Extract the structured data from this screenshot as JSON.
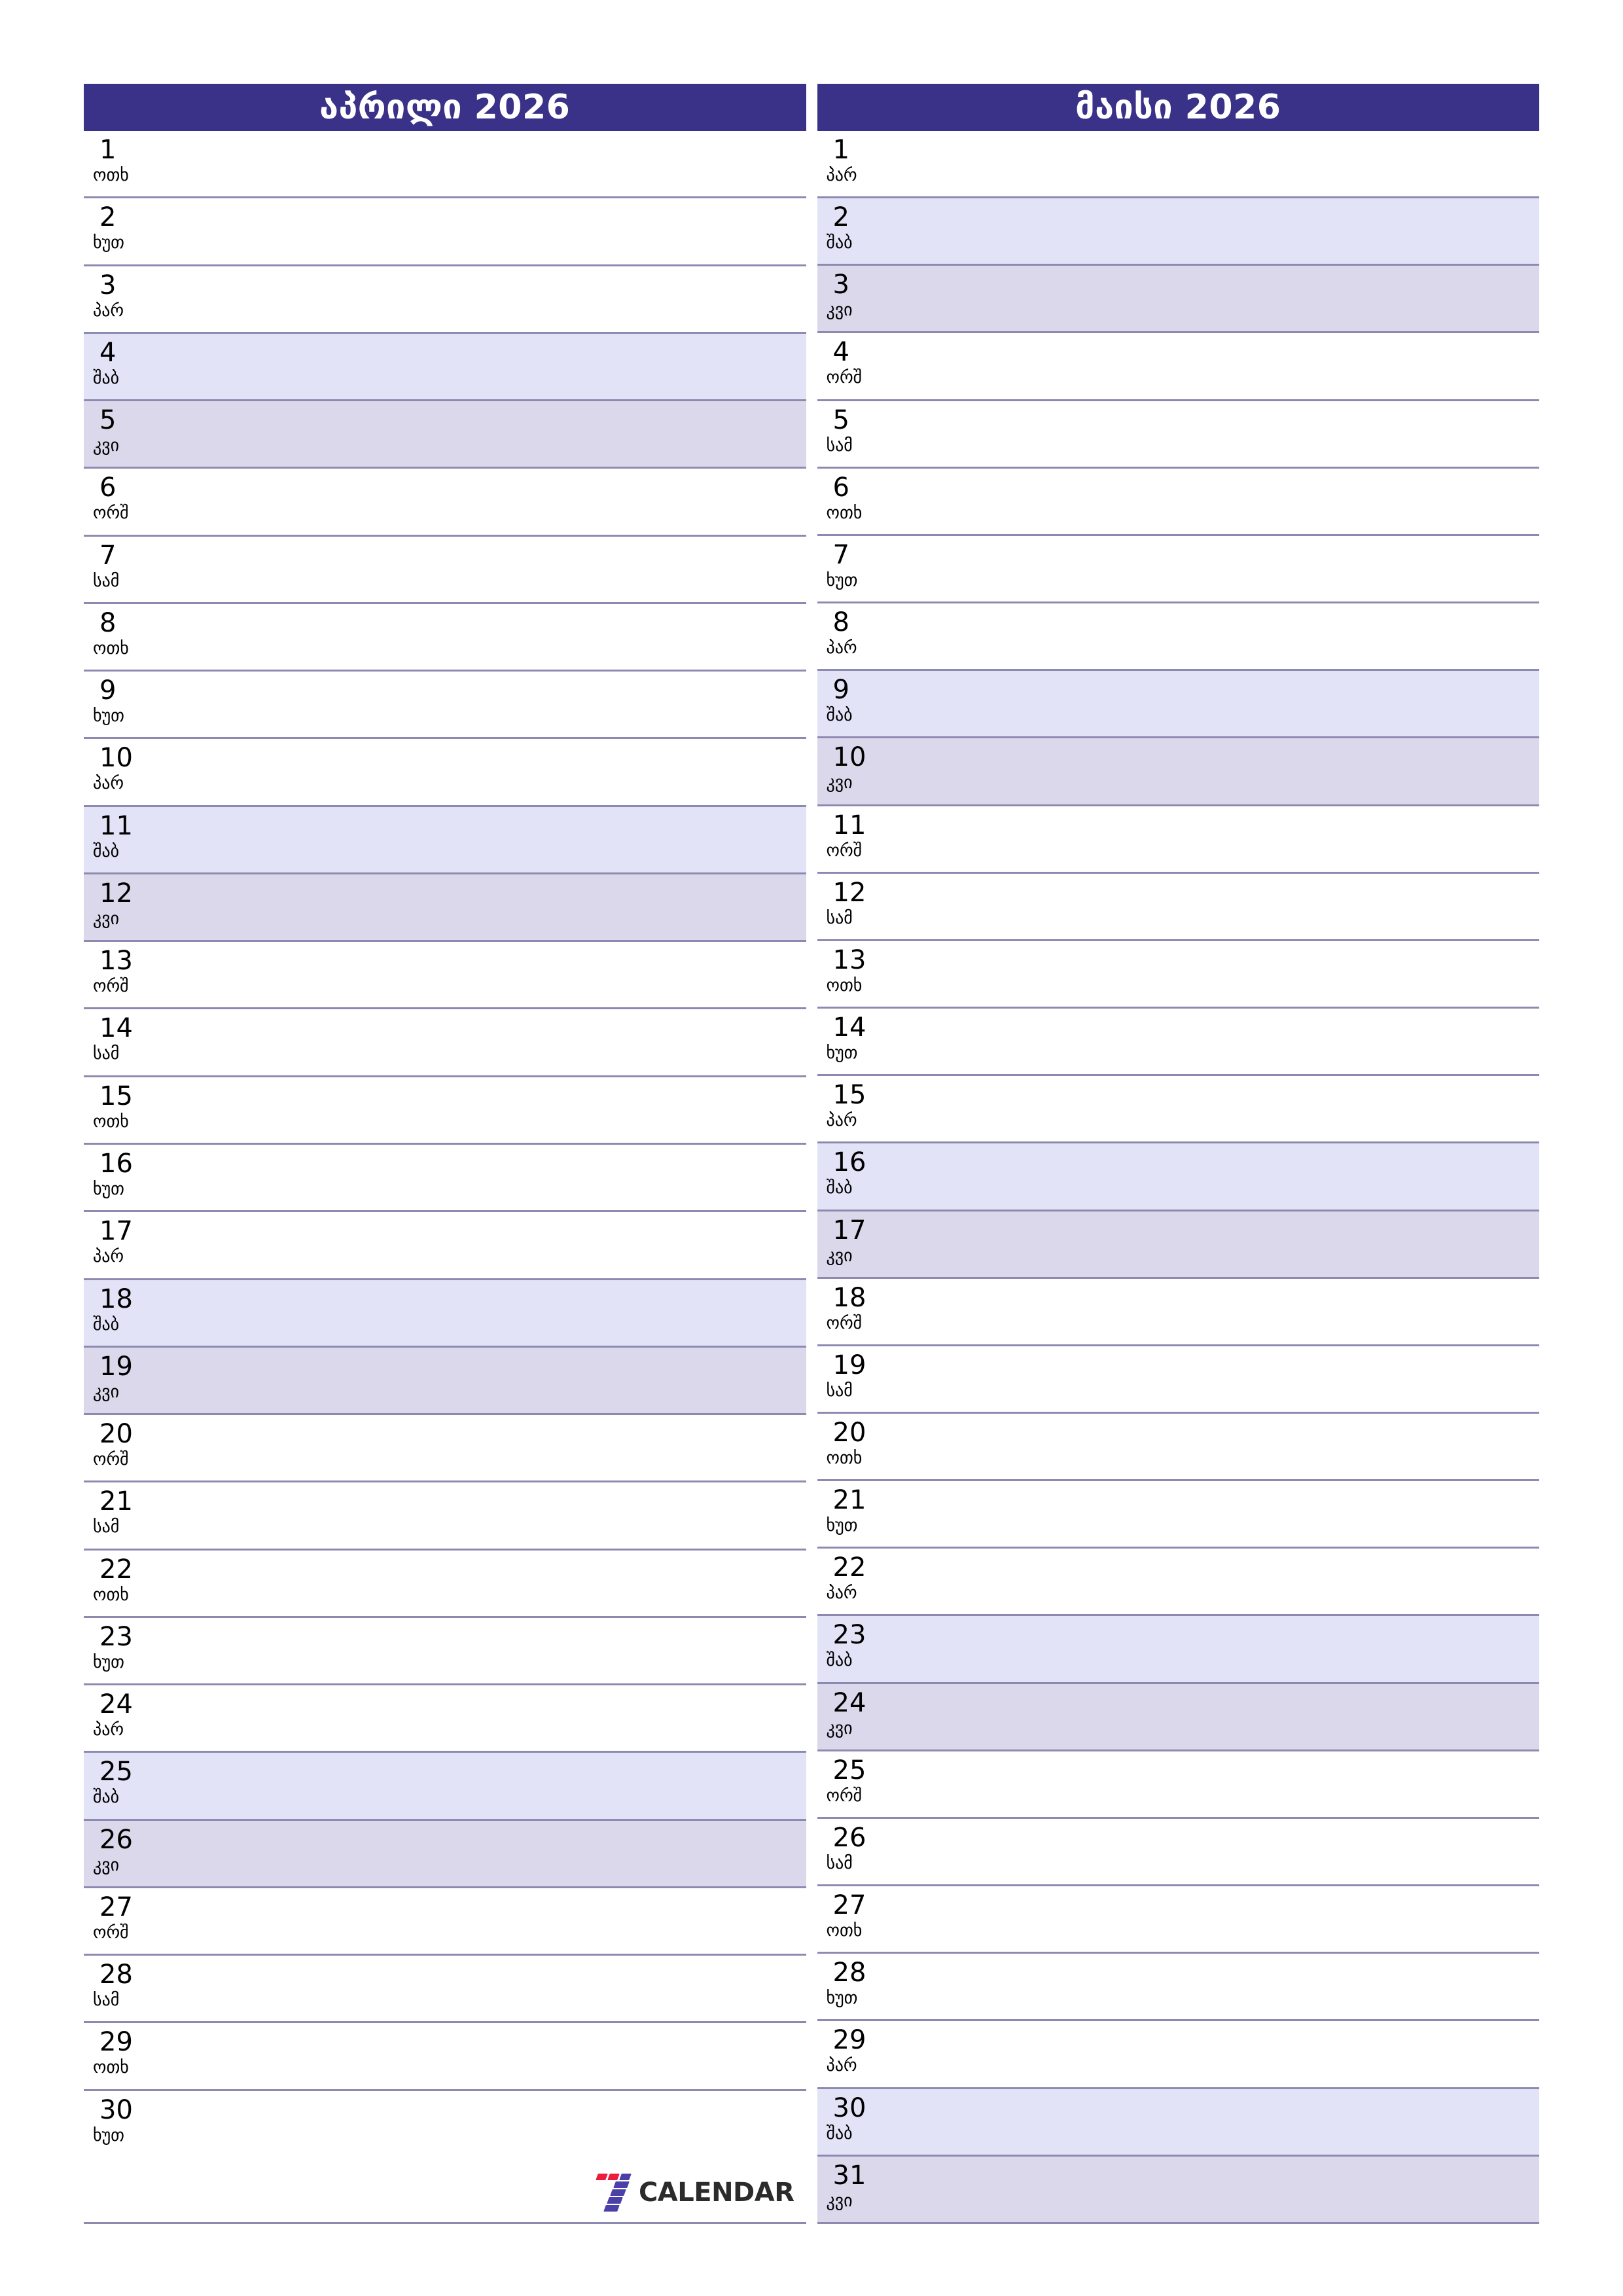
{
  "brand": {
    "logo_text": "CALENDAR",
    "mark_name": "seven-mark",
    "accent_red": "#ed1b3c",
    "accent_purple": "#4b3fa8",
    "header_color": "#3a3288",
    "saturday_color": "#e2e3f7",
    "sunday_color": "#dcd8ec",
    "rule_color": "#8c8ab0"
  },
  "months": [
    {
      "title": "აპრილი 2026",
      "days": [
        {
          "num": "1",
          "name": "ოთხ",
          "type": "weekday"
        },
        {
          "num": "2",
          "name": "ხუთ",
          "type": "weekday"
        },
        {
          "num": "3",
          "name": "პარ",
          "type": "weekday"
        },
        {
          "num": "4",
          "name": "შაბ",
          "type": "saturday"
        },
        {
          "num": "5",
          "name": "კვი",
          "type": "sunday"
        },
        {
          "num": "6",
          "name": "ორშ",
          "type": "weekday"
        },
        {
          "num": "7",
          "name": "სამ",
          "type": "weekday"
        },
        {
          "num": "8",
          "name": "ოთხ",
          "type": "weekday"
        },
        {
          "num": "9",
          "name": "ხუთ",
          "type": "weekday"
        },
        {
          "num": "10",
          "name": "პარ",
          "type": "weekday"
        },
        {
          "num": "11",
          "name": "შაბ",
          "type": "saturday"
        },
        {
          "num": "12",
          "name": "კვი",
          "type": "sunday"
        },
        {
          "num": "13",
          "name": "ორშ",
          "type": "weekday"
        },
        {
          "num": "14",
          "name": "სამ",
          "type": "weekday"
        },
        {
          "num": "15",
          "name": "ოთხ",
          "type": "weekday"
        },
        {
          "num": "16",
          "name": "ხუთ",
          "type": "weekday"
        },
        {
          "num": "17",
          "name": "პარ",
          "type": "weekday"
        },
        {
          "num": "18",
          "name": "შაბ",
          "type": "saturday"
        },
        {
          "num": "19",
          "name": "კვი",
          "type": "sunday"
        },
        {
          "num": "20",
          "name": "ორშ",
          "type": "weekday"
        },
        {
          "num": "21",
          "name": "სამ",
          "type": "weekday"
        },
        {
          "num": "22",
          "name": "ოთხ",
          "type": "weekday"
        },
        {
          "num": "23",
          "name": "ხუთ",
          "type": "weekday"
        },
        {
          "num": "24",
          "name": "პარ",
          "type": "weekday"
        },
        {
          "num": "25",
          "name": "შაბ",
          "type": "saturday"
        },
        {
          "num": "26",
          "name": "კვი",
          "type": "sunday"
        },
        {
          "num": "27",
          "name": "ორშ",
          "type": "weekday"
        },
        {
          "num": "28",
          "name": "სამ",
          "type": "weekday"
        },
        {
          "num": "29",
          "name": "ოთხ",
          "type": "weekday"
        },
        {
          "num": "30",
          "name": "ხუთ",
          "type": "weekday"
        },
        {
          "num": "",
          "name": "",
          "type": "weekday"
        }
      ]
    },
    {
      "title": "მაისი 2026",
      "days": [
        {
          "num": "1",
          "name": "პარ",
          "type": "weekday"
        },
        {
          "num": "2",
          "name": "შაბ",
          "type": "saturday"
        },
        {
          "num": "3",
          "name": "კვი",
          "type": "sunday"
        },
        {
          "num": "4",
          "name": "ორშ",
          "type": "weekday"
        },
        {
          "num": "5",
          "name": "სამ",
          "type": "weekday"
        },
        {
          "num": "6",
          "name": "ოთხ",
          "type": "weekday"
        },
        {
          "num": "7",
          "name": "ხუთ",
          "type": "weekday"
        },
        {
          "num": "8",
          "name": "პარ",
          "type": "weekday"
        },
        {
          "num": "9",
          "name": "შაბ",
          "type": "saturday"
        },
        {
          "num": "10",
          "name": "კვი",
          "type": "sunday"
        },
        {
          "num": "11",
          "name": "ორშ",
          "type": "weekday"
        },
        {
          "num": "12",
          "name": "სამ",
          "type": "weekday"
        },
        {
          "num": "13",
          "name": "ოთხ",
          "type": "weekday"
        },
        {
          "num": "14",
          "name": "ხუთ",
          "type": "weekday"
        },
        {
          "num": "15",
          "name": "პარ",
          "type": "weekday"
        },
        {
          "num": "16",
          "name": "შაბ",
          "type": "saturday"
        },
        {
          "num": "17",
          "name": "კვი",
          "type": "sunday"
        },
        {
          "num": "18",
          "name": "ორშ",
          "type": "weekday"
        },
        {
          "num": "19",
          "name": "სამ",
          "type": "weekday"
        },
        {
          "num": "20",
          "name": "ოთხ",
          "type": "weekday"
        },
        {
          "num": "21",
          "name": "ხუთ",
          "type": "weekday"
        },
        {
          "num": "22",
          "name": "პარ",
          "type": "weekday"
        },
        {
          "num": "23",
          "name": "შაბ",
          "type": "saturday"
        },
        {
          "num": "24",
          "name": "კვი",
          "type": "sunday"
        },
        {
          "num": "25",
          "name": "ორშ",
          "type": "weekday"
        },
        {
          "num": "26",
          "name": "სამ",
          "type": "weekday"
        },
        {
          "num": "27",
          "name": "ოთხ",
          "type": "weekday"
        },
        {
          "num": "28",
          "name": "ხუთ",
          "type": "weekday"
        },
        {
          "num": "29",
          "name": "პარ",
          "type": "weekday"
        },
        {
          "num": "30",
          "name": "შაბ",
          "type": "saturday"
        },
        {
          "num": "31",
          "name": "კვი",
          "type": "sunday"
        }
      ]
    }
  ]
}
